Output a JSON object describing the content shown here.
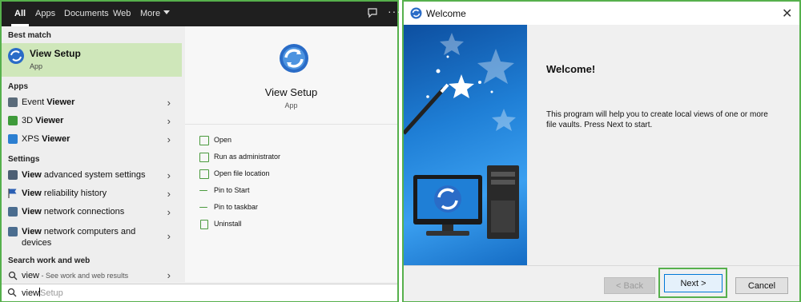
{
  "start_menu": {
    "tabs": [
      {
        "label": "All",
        "active": true
      },
      {
        "label": "Apps"
      },
      {
        "label": "Documents"
      },
      {
        "label": "Web"
      },
      {
        "label": "More"
      }
    ],
    "sections": {
      "best_match": "Best match",
      "apps": "Apps",
      "settings": "Settings",
      "search_web": "Search work and web"
    },
    "best_match": {
      "title": "View Setup",
      "subtitle": "App"
    },
    "apps": [
      {
        "prefix": "Event ",
        "match": "Viewer",
        "icon": "event-viewer-icon"
      },
      {
        "prefix": "3D ",
        "match": "Viewer",
        "icon": "3d-viewer-icon"
      },
      {
        "prefix": "XPS ",
        "match": "Viewer",
        "icon": "xps-viewer-icon"
      }
    ],
    "settings": [
      {
        "match": "View",
        "rest": " advanced system settings",
        "icon": "system-icon"
      },
      {
        "match": "View",
        "rest": " reliability history",
        "icon": "flag-icon"
      },
      {
        "match": "View",
        "rest": " network connections",
        "icon": "network-icon"
      },
      {
        "match": "View",
        "rest": " network computers and",
        "rest2": "devices",
        "icon": "network-icon"
      }
    ],
    "web_result": {
      "query": "view",
      "hint": " - See work and web results"
    },
    "preview": {
      "title": "View Setup",
      "subtitle": "App",
      "actions": [
        "Open",
        "Run as administrator",
        "Open file location",
        "Pin to Start",
        "Pin to taskbar",
        "Uninstall"
      ]
    },
    "search": {
      "typed": "view",
      "suggestion": "Setup"
    },
    "accent": "#56b04c"
  },
  "dialog": {
    "title": "Welcome",
    "heading": "Welcome!",
    "body_line1": "This program will help you to create local views of one or more",
    "body_line2": "file vaults. Press Next to start.",
    "buttons": {
      "back": "< Back",
      "next": "Next >",
      "cancel": "Cancel"
    }
  }
}
